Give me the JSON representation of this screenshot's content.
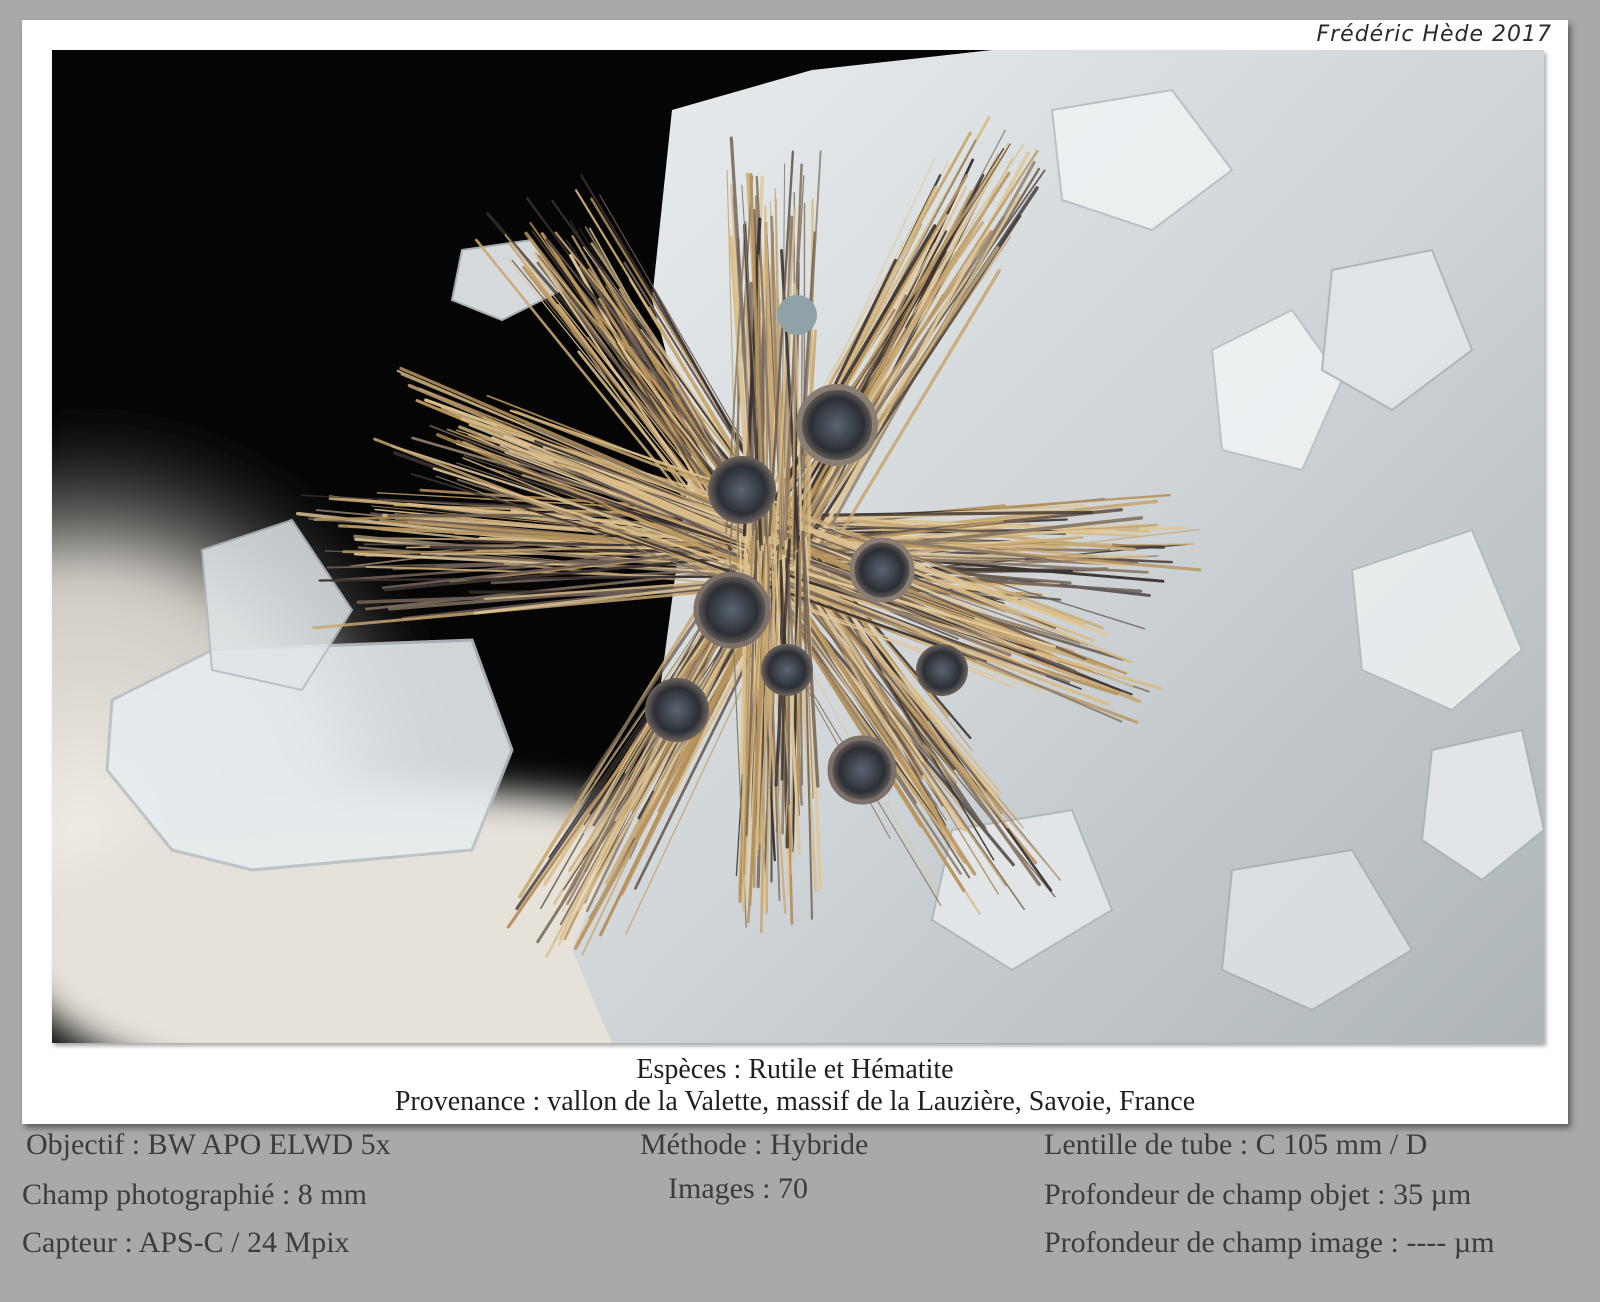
{
  "credit": "Frédéric Hède 2017",
  "photo": {
    "subject": "Rutile et Hématite",
    "background_color": "#000000"
  },
  "caption": {
    "species": "Espèces : Rutile et Hématite",
    "origin": "Provenance : vallon de la Valette, massif de la Lauzière, Savoie, France"
  },
  "specs": {
    "objective": "Objectif : BW APO ELWD 5x",
    "field": "Champ photographié : 8 mm",
    "sensor": "Capteur : APS-C / 24 Mpix",
    "method": "Méthode : Hybride",
    "images": "Images : 70",
    "tube_lens": "Lentille de tube : C 105 mm / D",
    "object_dof": "Profondeur de champ objet : 35 µm",
    "image_dof": "Profondeur de champ image : ---- µm"
  },
  "colors": {
    "page_bg": "#a9a9a9",
    "card_bg": "#ffffff",
    "spec_text": "#3c3c3c",
    "needle_tan": "#c9a873",
    "needle_dark": "#3b3330",
    "quartz": "#d8dde0"
  }
}
